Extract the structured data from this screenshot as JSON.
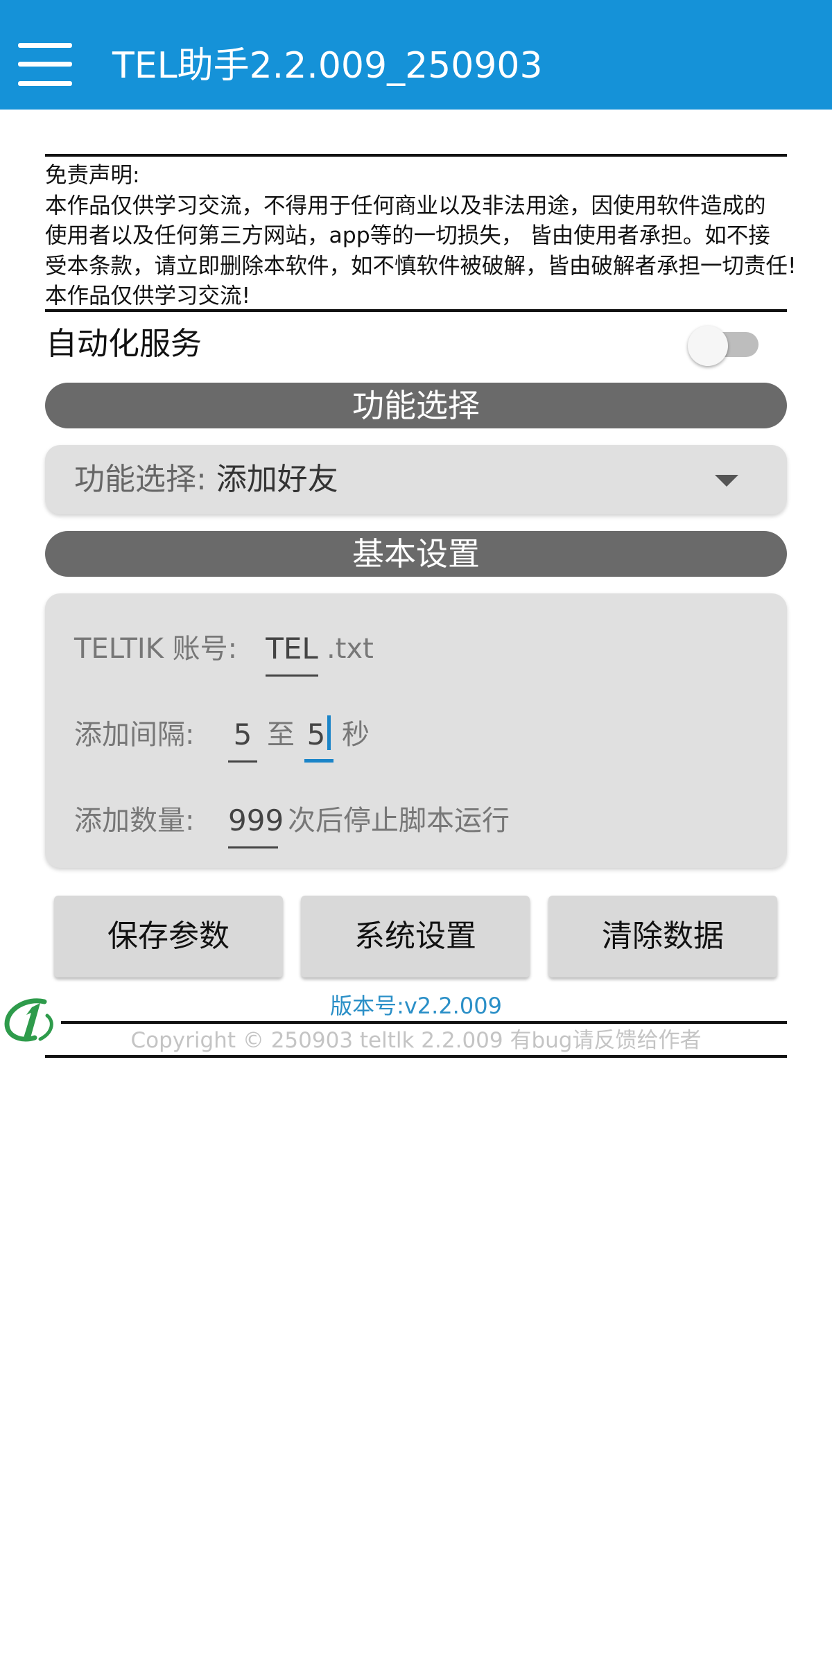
{
  "app_bar": {
    "title": "TEL助手2.2.009_250903",
    "background": "#1592d8",
    "menu_icon": "hamburger-menu-icon"
  },
  "disclaimer": {
    "lines": [
      "免责声明:",
      "本作品仅供学习交流，不得用于任何商业以及非法用途，因使用软件造成的",
      "使用者以及任何第三方网站，app等的一切损失， 皆由使用者承担。如不接",
      "受本条款，请立即删除本软件，如不慎软件被破解，皆由破解者承担一切责任!",
      "本作品仅供学习交流!"
    ]
  },
  "auto_service": {
    "label": "自动化服务",
    "enabled": false
  },
  "function_section": {
    "header": "功能选择",
    "spinner_label": "功能选择: ",
    "spinner_value": "添加好友"
  },
  "basic_section": {
    "header": "基本设置",
    "account_label": "TELTIK 账号:",
    "account_value": "TEL",
    "account_suffix": ".txt",
    "interval_label": "添加间隔:",
    "interval_from": "5",
    "interval_to_word": "至",
    "interval_to": "5",
    "interval_unit": "秒",
    "count_label": "添加数量:",
    "count_value": "999",
    "count_suffix": "次后停止脚本运行"
  },
  "buttons": {
    "save": "保存参数",
    "system": "系统设置",
    "clear": "清除数据"
  },
  "footer": {
    "version": "版本号:v2.2.009",
    "copyright": "Copyright © 250903 teltlk 2.2.009 有bug请反馈给作者",
    "logo_icon": "number-one-logo-icon"
  },
  "colors": {
    "section_header": "#6a6a6a",
    "card": "#e0e0e0",
    "accent": "#1a84c8",
    "version_text": "#2a8fc7"
  }
}
